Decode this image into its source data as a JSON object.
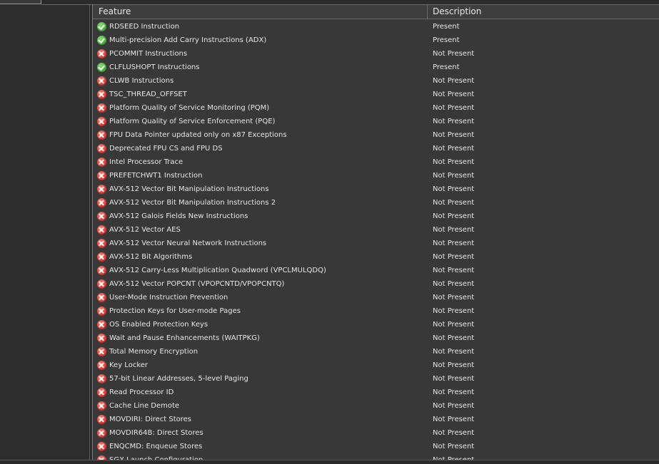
{
  "header": {
    "feature": "Feature",
    "description": "Description"
  },
  "rows": [
    {
      "icon": "check-icon",
      "feature": "RDSEED Instruction",
      "description": "Present"
    },
    {
      "icon": "check-icon",
      "feature": "Multi-precision Add Carry Instructions (ADX)",
      "description": "Present"
    },
    {
      "icon": "cross-icon",
      "feature": "PCOMMIT Instructions",
      "description": "Not Present"
    },
    {
      "icon": "check-icon",
      "feature": "CLFLUSHOPT Instructions",
      "description": "Present"
    },
    {
      "icon": "cross-icon",
      "feature": "CLWB Instructions",
      "description": "Not Present"
    },
    {
      "icon": "cross-icon",
      "feature": "TSC_THREAD_OFFSET",
      "description": "Not Present"
    },
    {
      "icon": "cross-icon",
      "feature": "Platform Quality of Service Monitoring (PQM)",
      "description": "Not Present"
    },
    {
      "icon": "cross-icon",
      "feature": "Platform Quality of Service Enforcement (PQE)",
      "description": "Not Present"
    },
    {
      "icon": "cross-icon",
      "feature": "FPU Data Pointer updated only on x87 Exceptions",
      "description": "Not Present"
    },
    {
      "icon": "cross-icon",
      "feature": "Deprecated FPU CS and FPU DS",
      "description": "Not Present"
    },
    {
      "icon": "cross-icon",
      "feature": "Intel Processor Trace",
      "description": "Not Present"
    },
    {
      "icon": "cross-icon",
      "feature": "PREFETCHWT1 Instruction",
      "description": "Not Present"
    },
    {
      "icon": "cross-icon",
      "feature": "AVX-512 Vector Bit Manipulation Instructions",
      "description": "Not Present"
    },
    {
      "icon": "cross-icon",
      "feature": "AVX-512 Vector Bit Manipulation Instructions 2",
      "description": "Not Present"
    },
    {
      "icon": "cross-icon",
      "feature": "AVX-512 Galois Fields New Instructions",
      "description": "Not Present"
    },
    {
      "icon": "cross-icon",
      "feature": "AVX-512 Vector AES",
      "description": "Not Present"
    },
    {
      "icon": "cross-icon",
      "feature": "AVX-512 Vector Neural Network Instructions",
      "description": "Not Present"
    },
    {
      "icon": "cross-icon",
      "feature": "AVX-512 Bit Algorithms",
      "description": "Not Present"
    },
    {
      "icon": "cross-icon",
      "feature": "AVX-512 Carry-Less Multiplication Quadword (VPCLMULQDQ)",
      "description": "Not Present"
    },
    {
      "icon": "cross-icon",
      "feature": "AVX-512 Vector POPCNT (VPOPCNTD/VPOPCNTQ)",
      "description": "Not Present"
    },
    {
      "icon": "cross-icon",
      "feature": "User-Mode Instruction Prevention",
      "description": "Not Present"
    },
    {
      "icon": "cross-icon",
      "feature": "Protection Keys for User-mode Pages",
      "description": "Not Present"
    },
    {
      "icon": "cross-icon",
      "feature": "OS Enabled Protection Keys",
      "description": "Not Present"
    },
    {
      "icon": "cross-icon",
      "feature": "Wait and Pause Enhancements (WAITPKG)",
      "description": "Not Present"
    },
    {
      "icon": "cross-icon",
      "feature": "Total Memory Encryption",
      "description": "Not Present"
    },
    {
      "icon": "cross-icon",
      "feature": "Key Locker",
      "description": "Not Present"
    },
    {
      "icon": "cross-icon",
      "feature": "57-bit Linear Addresses, 5-level Paging",
      "description": "Not Present"
    },
    {
      "icon": "cross-icon",
      "feature": "Read Processor ID",
      "description": "Not Present"
    },
    {
      "icon": "cross-icon",
      "feature": "Cache Line Demote",
      "description": "Not Present"
    },
    {
      "icon": "cross-icon",
      "feature": "MOVDIRI: Direct Stores",
      "description": "Not Present"
    },
    {
      "icon": "cross-icon",
      "feature": "MOVDIR64B: Direct Stores",
      "description": "Not Present"
    },
    {
      "icon": "cross-icon",
      "feature": "ENQCMD: Enqueue Stores",
      "description": "Not Present"
    },
    {
      "icon": "cross-icon",
      "feature": "SGX Launch Configuration",
      "description": "Not Present"
    }
  ]
}
